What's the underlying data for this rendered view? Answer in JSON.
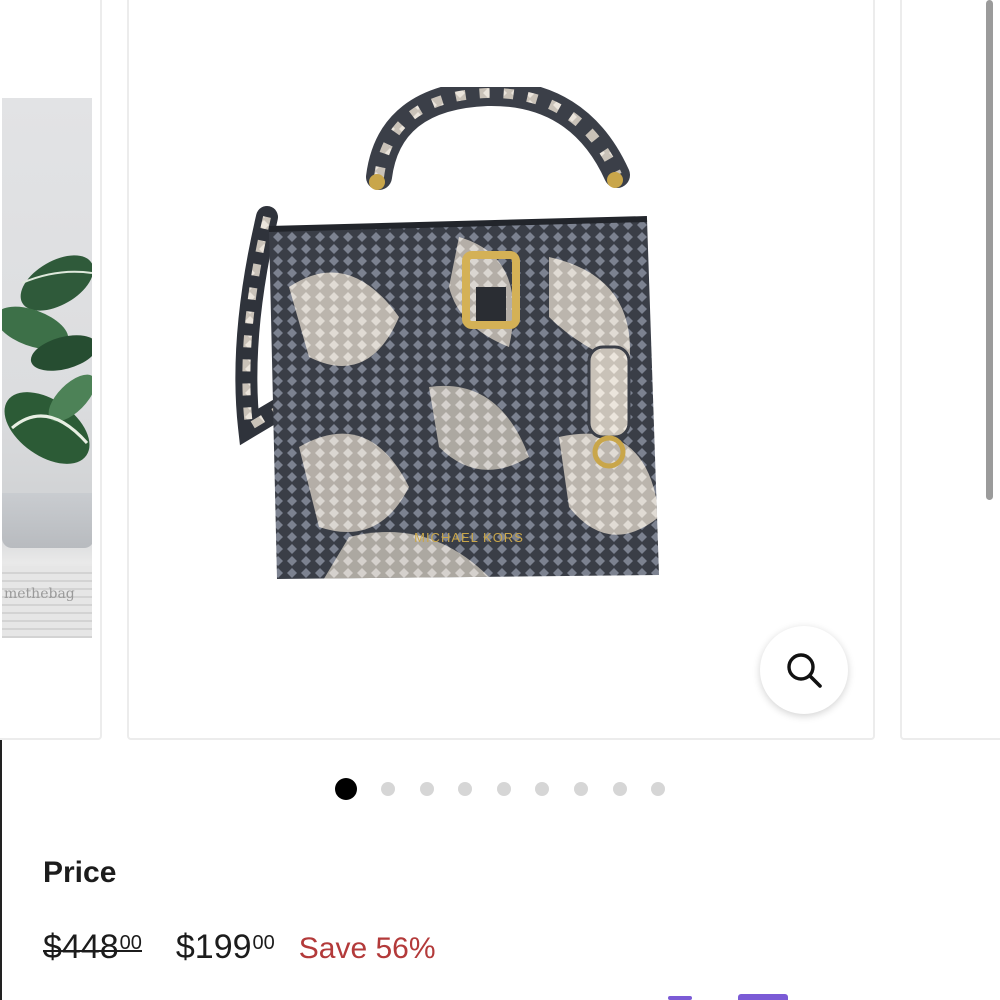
{
  "carousel": {
    "prev_watermark": "methebag",
    "main_image_brand": "MICHAEL KORS",
    "zoom_icon": "search-icon",
    "dot_count": 9,
    "active_dot": 1
  },
  "price": {
    "label": "Price",
    "original_whole": "$448",
    "original_cents": "00",
    "sale_whole": "$199",
    "sale_cents": "00",
    "save_text": "Save 56%"
  },
  "colors": {
    "save_red": "#b33a3a",
    "dot_active": "#000000",
    "dot_inactive": "#d6d6d6"
  }
}
